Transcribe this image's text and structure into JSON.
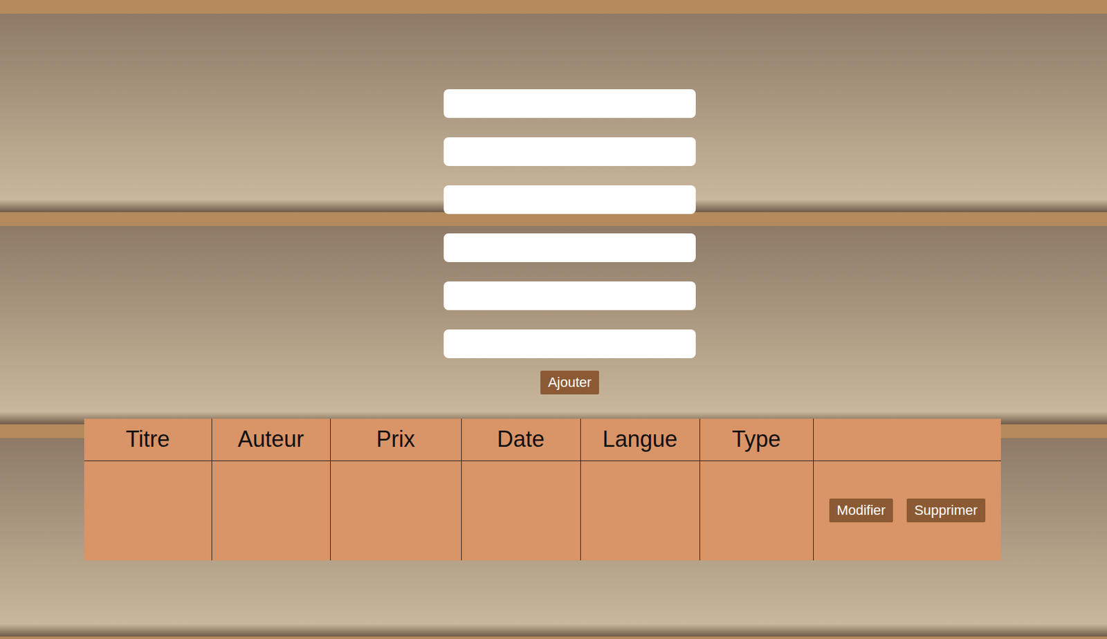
{
  "form": {
    "fields": [
      {
        "value": ""
      },
      {
        "value": ""
      },
      {
        "value": ""
      },
      {
        "value": ""
      },
      {
        "value": ""
      },
      {
        "value": ""
      }
    ],
    "submit": "Ajouter"
  },
  "table": {
    "columns": [
      "Titre",
      "Auteur",
      "Prix",
      "Date",
      "Langue",
      "Type",
      ""
    ],
    "rows": [
      {
        "cells": [
          "",
          "",
          "",
          "",
          "",
          ""
        ],
        "actions": [
          "Modifier",
          "Supprimer"
        ]
      }
    ]
  }
}
